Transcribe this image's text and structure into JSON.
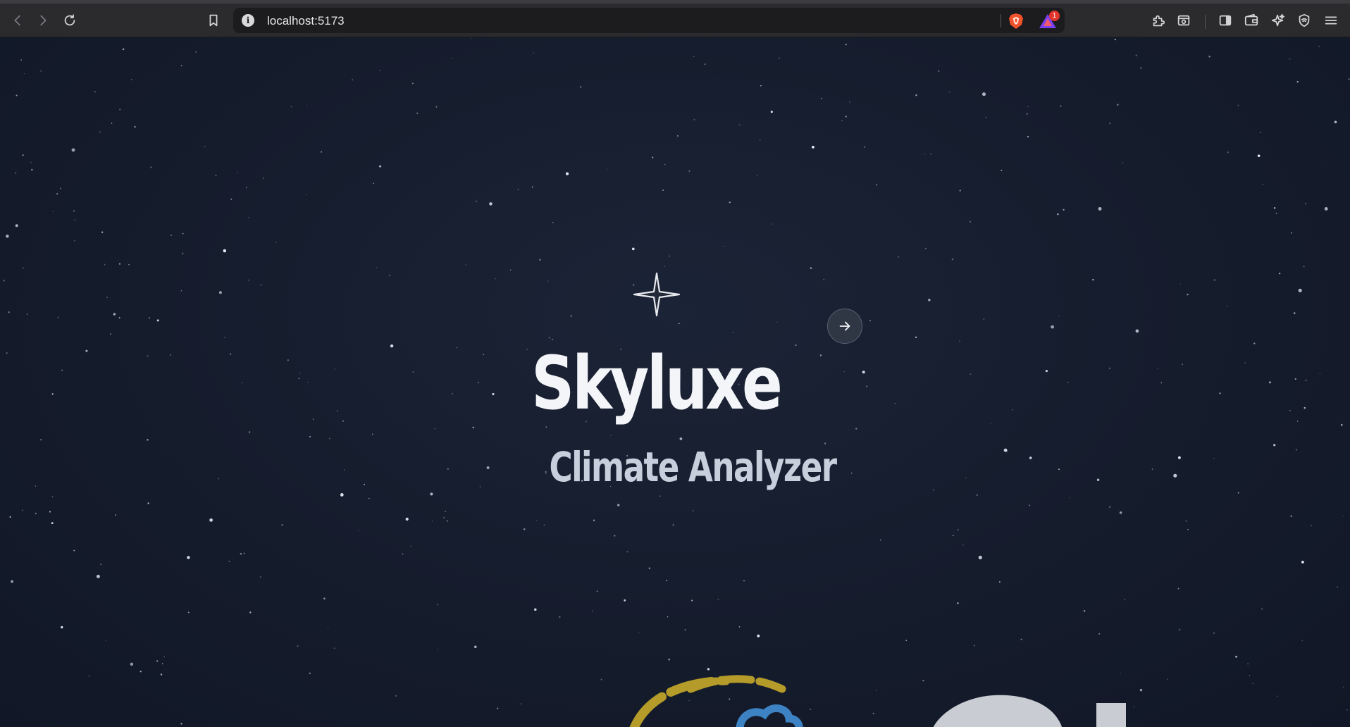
{
  "browser": {
    "address": "localhost:5173",
    "rewards_badge": "1",
    "toolbar_icons": [
      "back-icon",
      "forward-icon",
      "reload-icon",
      "bookmark-icon",
      "site-info-icon",
      "brave-shields-icon",
      "brave-rewards-icon",
      "extensions-icon",
      "reader-mode-icon",
      "sidebar-icon",
      "wallet-icon",
      "leo-ai-icon",
      "vpn-icon",
      "menu-icon"
    ]
  },
  "hero": {
    "icon": "sparkle-star-icon",
    "title": "Skyluxe",
    "subtitle": "Climate Analyzer",
    "next_icon": "arrow-right-icon"
  },
  "colors": {
    "background": "#151c2c",
    "title": "#f4f5f8",
    "subtitle": "#c8cfdc",
    "logo_yellow": "#b59b2a",
    "logo_blue": "#3d83c4"
  }
}
